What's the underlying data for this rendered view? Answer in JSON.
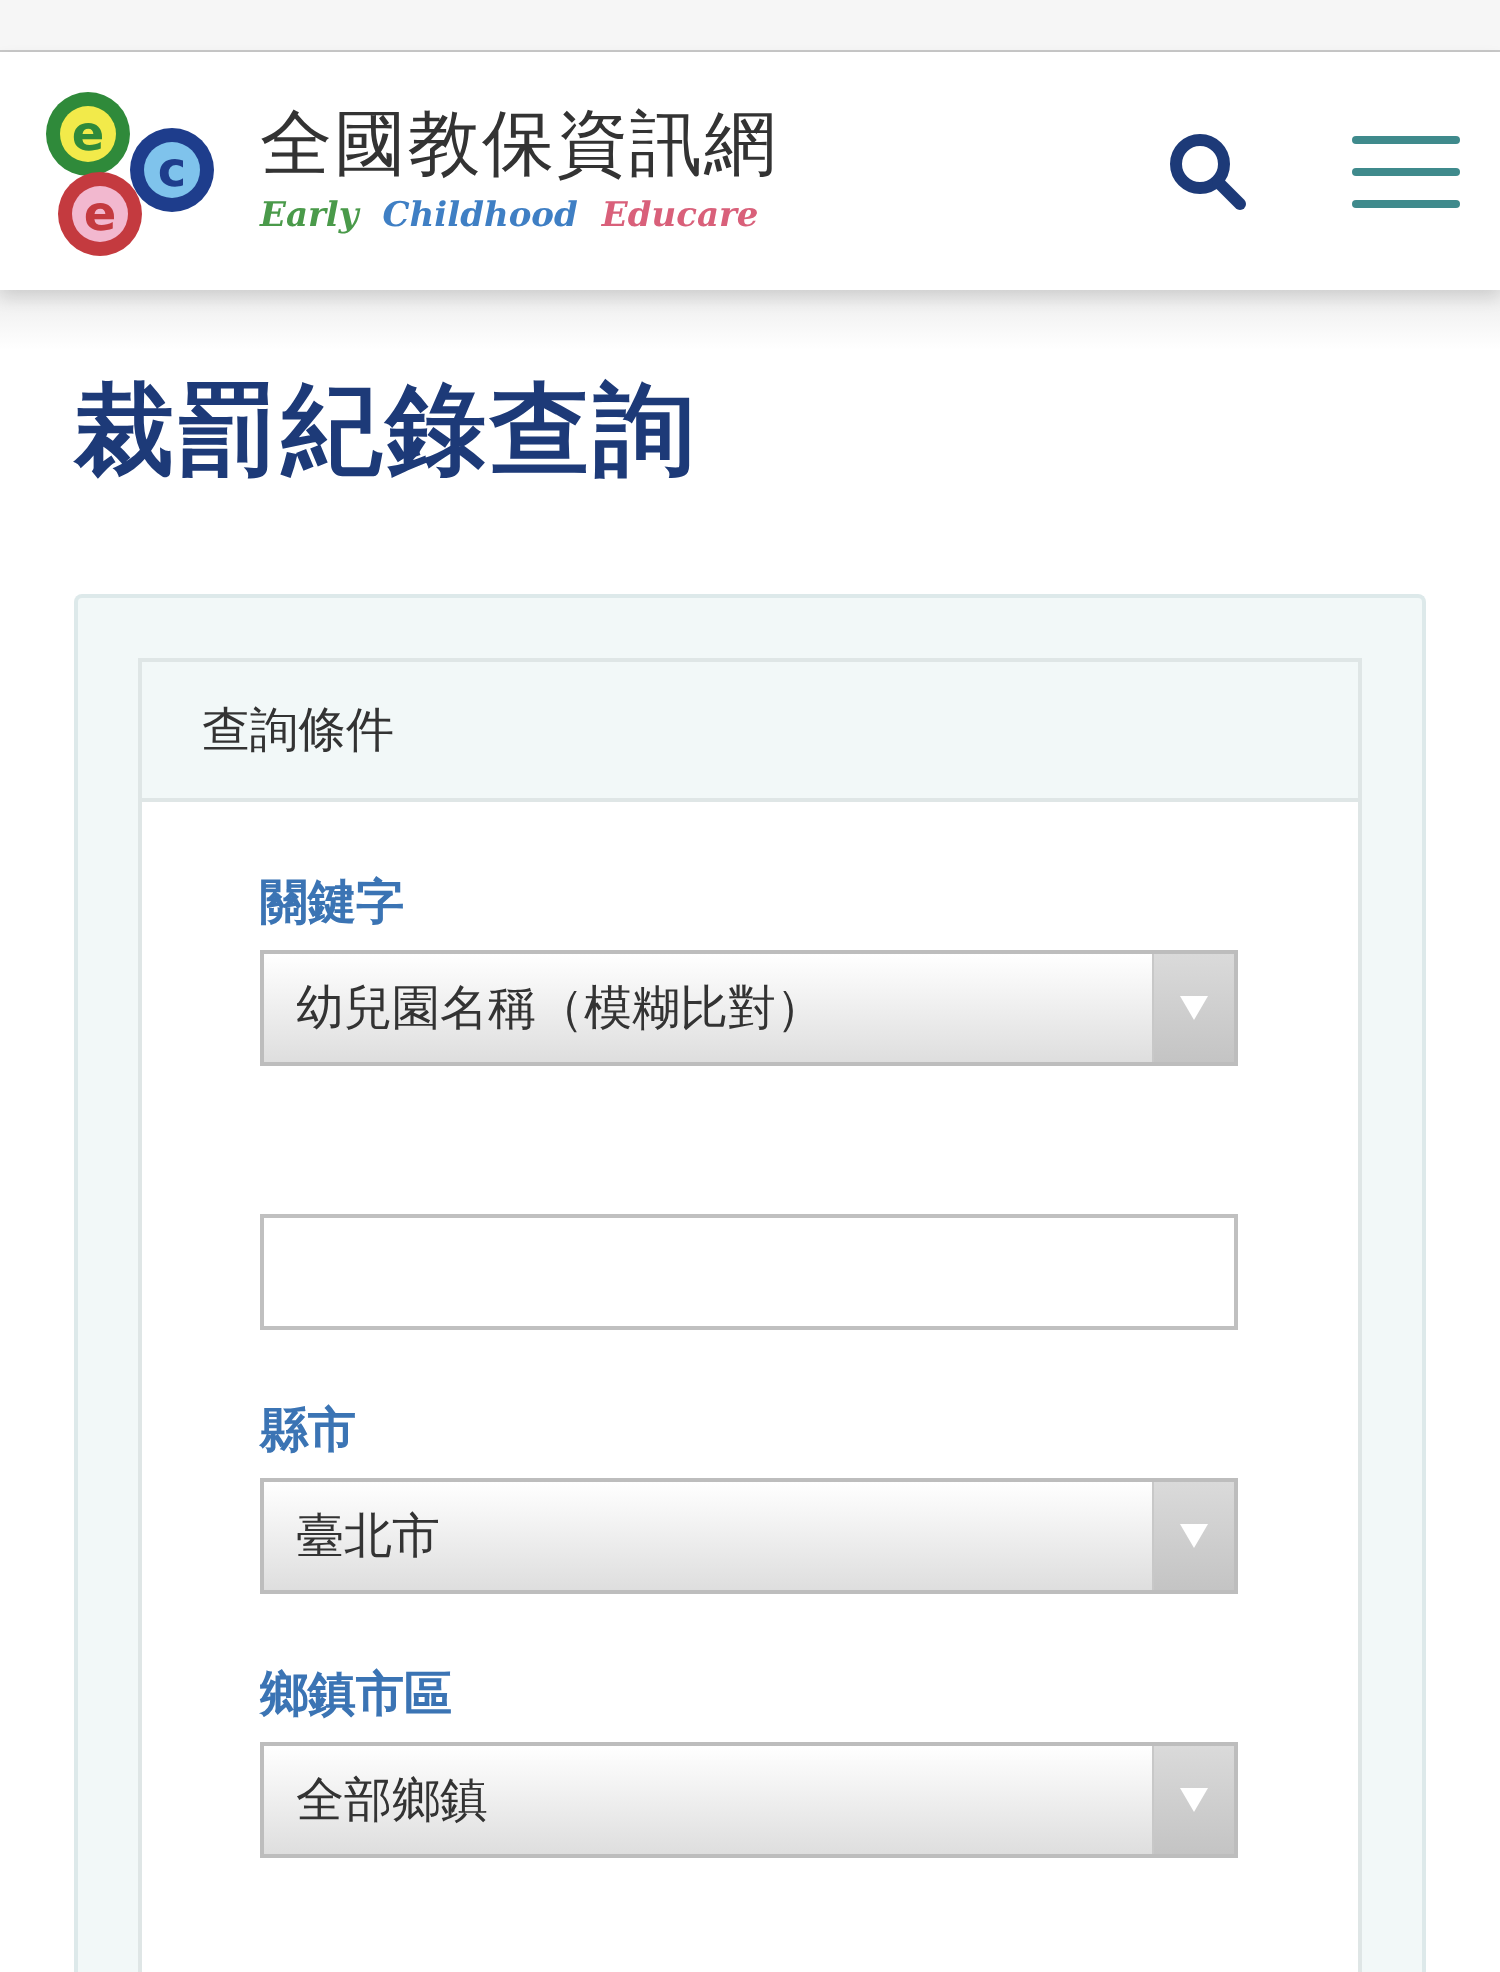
{
  "header": {
    "logo_letters": [
      {
        "text": "e",
        "color": "#f2ea4a"
      },
      {
        "text": "c",
        "color": "#7fc3ec"
      },
      {
        "text": "e",
        "color": "#f2b8cf"
      }
    ],
    "site_name": "全國教保資訊網",
    "tagline": [
      {
        "text": "Early",
        "color": "#4a9a4a"
      },
      {
        "text": "Childhood",
        "color": "#3f7fc4"
      },
      {
        "text": "Educare",
        "color": "#d9607a"
      }
    ]
  },
  "page_title": "裁罰紀錄查詢",
  "panel": {
    "title": "查詢條件",
    "fields": [
      {
        "kind": "select",
        "label": "關鍵字",
        "value": "幼兒園名稱（模糊比對）"
      },
      {
        "kind": "text"
      },
      {
        "kind": "select",
        "label": "縣市",
        "value": "臺北市"
      },
      {
        "kind": "select",
        "label": "鄉鎮市區",
        "value": "全部鄉鎮"
      }
    ]
  }
}
